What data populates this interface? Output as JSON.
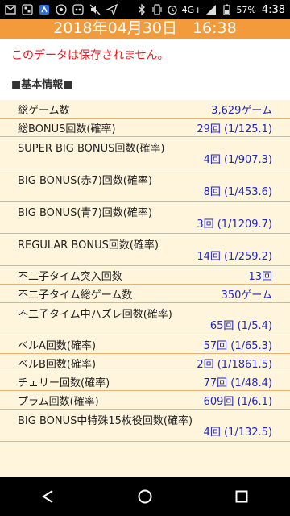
{
  "status": {
    "network": "4G+",
    "battery": "57%",
    "time": "4:38"
  },
  "header": {
    "date_time": "2018年04月30日　16:38"
  },
  "warning": "このデータは保存されません。",
  "section_title": "■基本情報■",
  "rows": [
    {
      "label": "総ゲーム数",
      "value": "3,629ゲーム"
    },
    {
      "label": "総BONUS回数(確率)",
      "value": "29回 (1/125.1)"
    },
    {
      "label": "SUPER BIG BONUS回数(確率)",
      "value": "4回 (1/907.3)"
    },
    {
      "label": "BIG BONUS(赤7)回数(確率)",
      "value": "8回 (1/453.6)"
    },
    {
      "label": "BIG BONUS(青7)回数(確率)",
      "value": "3回 (1/1209.7)"
    },
    {
      "label": "REGULAR BONUS回数(確率)",
      "value": "14回 (1/259.2)"
    },
    {
      "label": "不二子タイム突入回数",
      "value": "13回"
    },
    {
      "label": "不二子タイム総ゲーム数",
      "value": "350ゲーム"
    },
    {
      "label": "不二子タイム中ハズレ回数(確率)",
      "value": "65回 (1/5.4)"
    },
    {
      "label": "ベルA回数(確率)",
      "value": "57回 (1/65.3)"
    },
    {
      "label": "ベルB回数(確率)",
      "value": "2回 (1/1861.5)"
    },
    {
      "label": "チェリー回数(確率)",
      "value": "77回 (1/48.4)"
    },
    {
      "label": "プラム回数(確率)",
      "value": "609回 (1/6.1)"
    },
    {
      "label": "BIG BONUS中特殊15枚役回数(確率)",
      "value": "4回 (1/132.5)"
    }
  ]
}
